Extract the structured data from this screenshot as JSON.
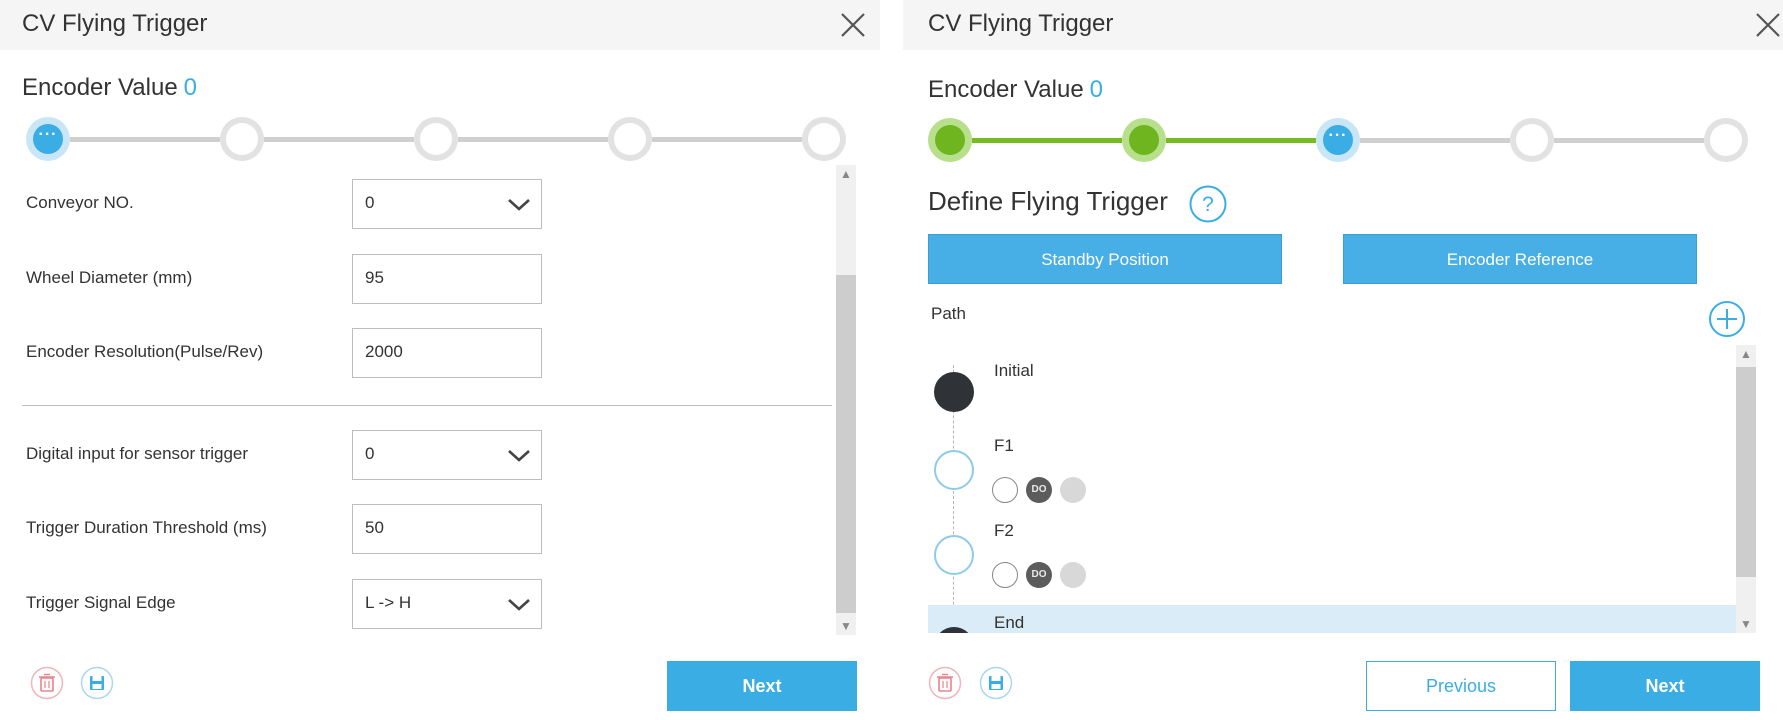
{
  "left": {
    "title": "CV Flying Trigger",
    "encoder_label": "Encoder Value",
    "encoder_value": "0",
    "fields": [
      {
        "label": "Conveyor NO.",
        "value": "0",
        "type": "select"
      },
      {
        "label": "Wheel Diameter (mm)",
        "value": "95",
        "type": "input"
      },
      {
        "label": "Encoder Resolution(Pulse/Rev)",
        "value": "2000",
        "type": "input"
      },
      {
        "label": "Digital input for sensor trigger",
        "value": "0",
        "type": "select"
      },
      {
        "label": "Trigger Duration Threshold (ms)",
        "value": "50",
        "type": "input"
      },
      {
        "label": "Trigger Signal Edge",
        "value": "L -> H",
        "type": "select"
      }
    ],
    "next_label": "Next",
    "steps": [
      "current",
      "todo",
      "todo",
      "todo",
      "todo"
    ]
  },
  "right": {
    "title": "CV Flying Trigger",
    "encoder_label": "Encoder Value",
    "encoder_value": "0",
    "section_title": "Define Flying Trigger",
    "standby_label": "Standby Position",
    "encoder_ref_label": "Encoder Reference",
    "path_label": "Path",
    "path_items": [
      {
        "name": "Initial",
        "node": "filled",
        "icons": false
      },
      {
        "name": "F1",
        "node": "open",
        "icons": true,
        "do_label": "DO"
      },
      {
        "name": "F2",
        "node": "open",
        "icons": true,
        "do_label": "DO"
      },
      {
        "name": "End",
        "node": "filled",
        "icons": false,
        "selected": true
      }
    ],
    "previous_label": "Previous",
    "next_label": "Next",
    "steps": [
      "done",
      "done",
      "current",
      "todo",
      "todo"
    ]
  },
  "colors": {
    "accent": "#3aade4",
    "done": "#6fb51f",
    "delete": "#e8838a"
  }
}
